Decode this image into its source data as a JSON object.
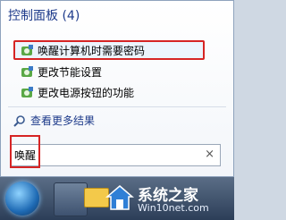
{
  "search_results": {
    "group_title": "控制面板 (4)",
    "items": [
      {
        "label": "唤醒计算机时需要密码",
        "icon": "control-panel-icon"
      },
      {
        "label": "更改节能设置",
        "icon": "control-panel-icon"
      },
      {
        "label": "更改电源按钮的功能",
        "icon": "control-panel-icon"
      }
    ],
    "see_more": "查看更多结果"
  },
  "search_box": {
    "value": "唤醒",
    "clear_glyph": "×"
  },
  "watermark": {
    "title": "系统之家",
    "site": "Win10net.com"
  },
  "colors": {
    "highlight": "#d62424",
    "group_title": "#1e3b8b"
  }
}
